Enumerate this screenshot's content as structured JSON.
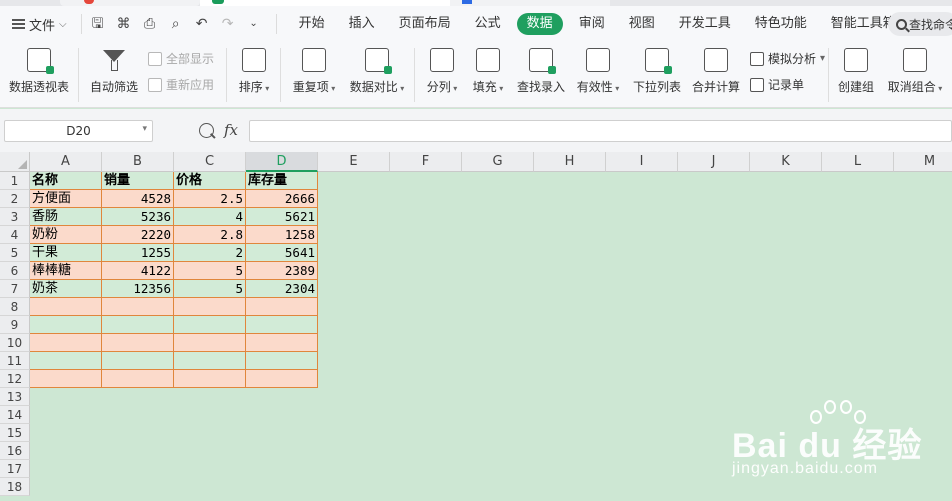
{
  "menubar": {
    "file_label": "文件",
    "tabs": [
      "开始",
      "插入",
      "页面布局",
      "公式",
      "数据",
      "审阅",
      "视图",
      "开发工具",
      "特色功能",
      "智能工具箱"
    ],
    "active_tab": "数据",
    "search_text": "查找命令"
  },
  "ribbon": {
    "pivot": "数据透视表",
    "autofilter": "自动筛选",
    "show_all": "全部显示",
    "reapply": "重新应用",
    "sort": "排序",
    "duplicates": "重复项",
    "compare": "数据对比",
    "split": "分列",
    "fill": "填充",
    "find_entry": "查找录入",
    "validity": "有效性",
    "dropdown_list": "下拉列表",
    "consolidate": "合并计算",
    "simulate": "模拟分析",
    "record_form": "记录单",
    "create_group": "创建组",
    "ungroup": "取消组合"
  },
  "formula_bar": {
    "name_box": "D20",
    "fx_label": "fx",
    "formula": ""
  },
  "sheet": {
    "columns": [
      "A",
      "B",
      "C",
      "D",
      "E",
      "F",
      "G",
      "H",
      "I",
      "J",
      "K",
      "L",
      "M"
    ],
    "selected_column": "D",
    "rows": [
      "1",
      "2",
      "3",
      "4",
      "5",
      "6",
      "7",
      "8",
      "9",
      "10",
      "11",
      "12",
      "13",
      "14",
      "15",
      "16",
      "17",
      "18"
    ],
    "header": [
      "名称",
      "销量",
      "价格",
      "库存量"
    ],
    "data": [
      [
        "方便面",
        "4528",
        "2.5",
        "2666"
      ],
      [
        "香肠",
        "5236",
        "4",
        "5621"
      ],
      [
        "奶粉",
        "2220",
        "2.8",
        "1258"
      ],
      [
        "干果",
        "1255",
        "2",
        "5641"
      ],
      [
        "棒棒糖",
        "4122",
        "5",
        "2389"
      ],
      [
        "奶茶",
        "12356",
        "5",
        "2304"
      ]
    ]
  },
  "watermark": {
    "brand": "Bai du 经验",
    "url": "jingyan.baidu.com"
  },
  "colors": {
    "accent": "#1f9f5f",
    "sheet_bg": "#cde7d3",
    "row_pink": "#fbdacb",
    "row_green": "#d2ebd7",
    "cell_border": "#e0863c"
  }
}
